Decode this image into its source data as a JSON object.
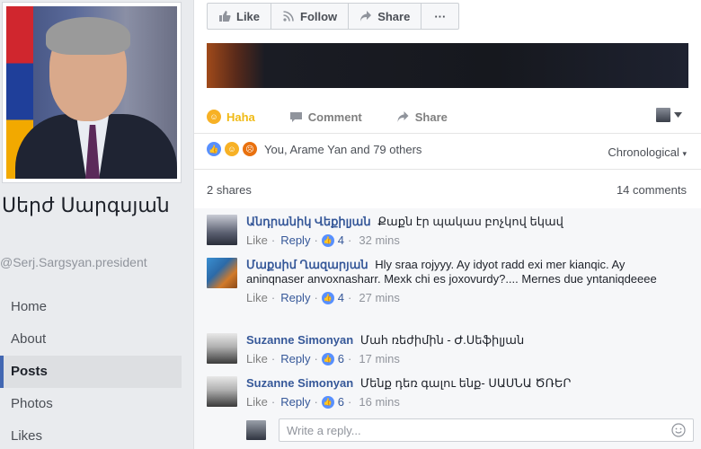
{
  "profile": {
    "name": "Սերժ Սարգսյան",
    "handle": "@Serj.Sargsyan.president",
    "nav": [
      {
        "label": "Home",
        "active": false
      },
      {
        "label": "About",
        "active": false
      },
      {
        "label": "Posts",
        "active": true
      },
      {
        "label": "Photos",
        "active": false
      },
      {
        "label": "Likes",
        "active": false
      }
    ]
  },
  "page_actions": {
    "like": "Like",
    "follow": "Follow",
    "share": "Share",
    "more": "···"
  },
  "post_actions": {
    "reaction": "Haha",
    "comment": "Comment",
    "share": "Share"
  },
  "reactions": {
    "summary": "You, Arame Yan and 79 others",
    "sort": "Chronological"
  },
  "stats": {
    "shares": "2 shares",
    "comments": "14 comments"
  },
  "comments": [
    {
      "author": "Անդրանիկ Վեքիլյան",
      "text": "Քաքն էր պակաս բոչկով եկավ",
      "like": "Like",
      "reply": "Reply",
      "reactions": "4",
      "time": "32 mins"
    },
    {
      "author": "Մաքսիմ Ղազարյան",
      "text": "Hly sraa rojyyy. Ay idyot radd exi mer kianqic. Ay aninqnaser anvoxnasharr. Mexk chi es joxovurdy?.... Mernes due yntaniqdeeee",
      "like": "Like",
      "reply": "Reply",
      "reactions": "4",
      "time": "27 mins"
    },
    {
      "author": "Suzanne Simonyan",
      "text": "Մահ ռեժիմին - Ժ.Սեֆիլյան",
      "like": "Like",
      "reply": "Reply",
      "reactions": "6",
      "time": "17 mins"
    },
    {
      "author": "Suzanne Simonyan",
      "text": "Մենք դեռ գալու ենք- ՍԱՍՆԱ ԾՌԵՐ",
      "like": "Like",
      "reply": "Reply",
      "reactions": "6",
      "time": "16 mins"
    }
  ],
  "reply": {
    "placeholder": "Write a reply..."
  },
  "colors": {
    "link": "#365899",
    "haha": "#f0ba15",
    "nav_active_bar": "#4267b2",
    "like_blue": "#5890ff"
  }
}
